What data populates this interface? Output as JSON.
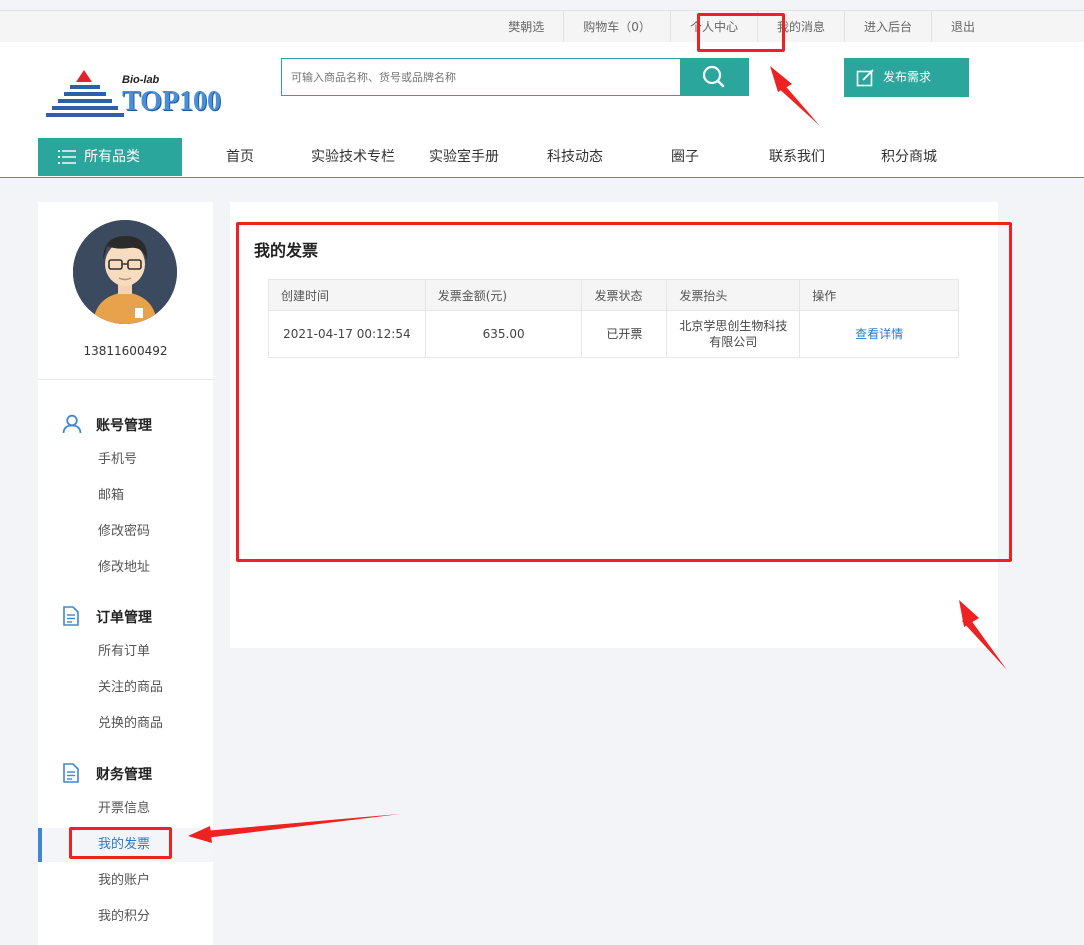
{
  "topbar": {
    "links": [
      "樊朝选",
      "购物车（0）",
      "个人中心",
      "我的消息",
      "进入后台",
      "退出"
    ]
  },
  "header": {
    "logo_tag": "Bio-lab",
    "logo_name": "TOP100",
    "search_placeholder": "可输入商品名称、货号或品牌名称",
    "publish_label": "发布需求",
    "category_label": "所有品类",
    "nav": [
      "首页",
      "实验技术专栏",
      "实验室手册",
      "科技动态",
      "圈子",
      "联系我们",
      "积分商城"
    ]
  },
  "sidebar": {
    "phone": "13811600492",
    "groups": [
      {
        "title": "账号管理",
        "icon": "user-icon",
        "items": [
          "手机号",
          "邮箱",
          "修改密码",
          "修改地址"
        ]
      },
      {
        "title": "订单管理",
        "icon": "document-icon",
        "items": [
          "所有订单",
          "关注的商品",
          "兑换的商品"
        ]
      },
      {
        "title": "财务管理",
        "icon": "document-icon",
        "items": [
          "开票信息",
          "我的发票",
          "我的账户",
          "我的积分"
        ]
      }
    ],
    "active_item": "我的发票"
  },
  "main": {
    "title": "我的发票",
    "table": {
      "headers": [
        "创建时间",
        "发票金额(元)",
        "发票状态",
        "发票抬头",
        "操作"
      ],
      "rows": [
        [
          "2021-04-17 00:12:54",
          "635.00",
          "已开票",
          "北京学思创生物科技有限公司",
          "查看详情"
        ]
      ]
    }
  },
  "colors": {
    "accent": "#2aa69d",
    "link": "#2a7bc8",
    "annotation": "#ee2222"
  }
}
